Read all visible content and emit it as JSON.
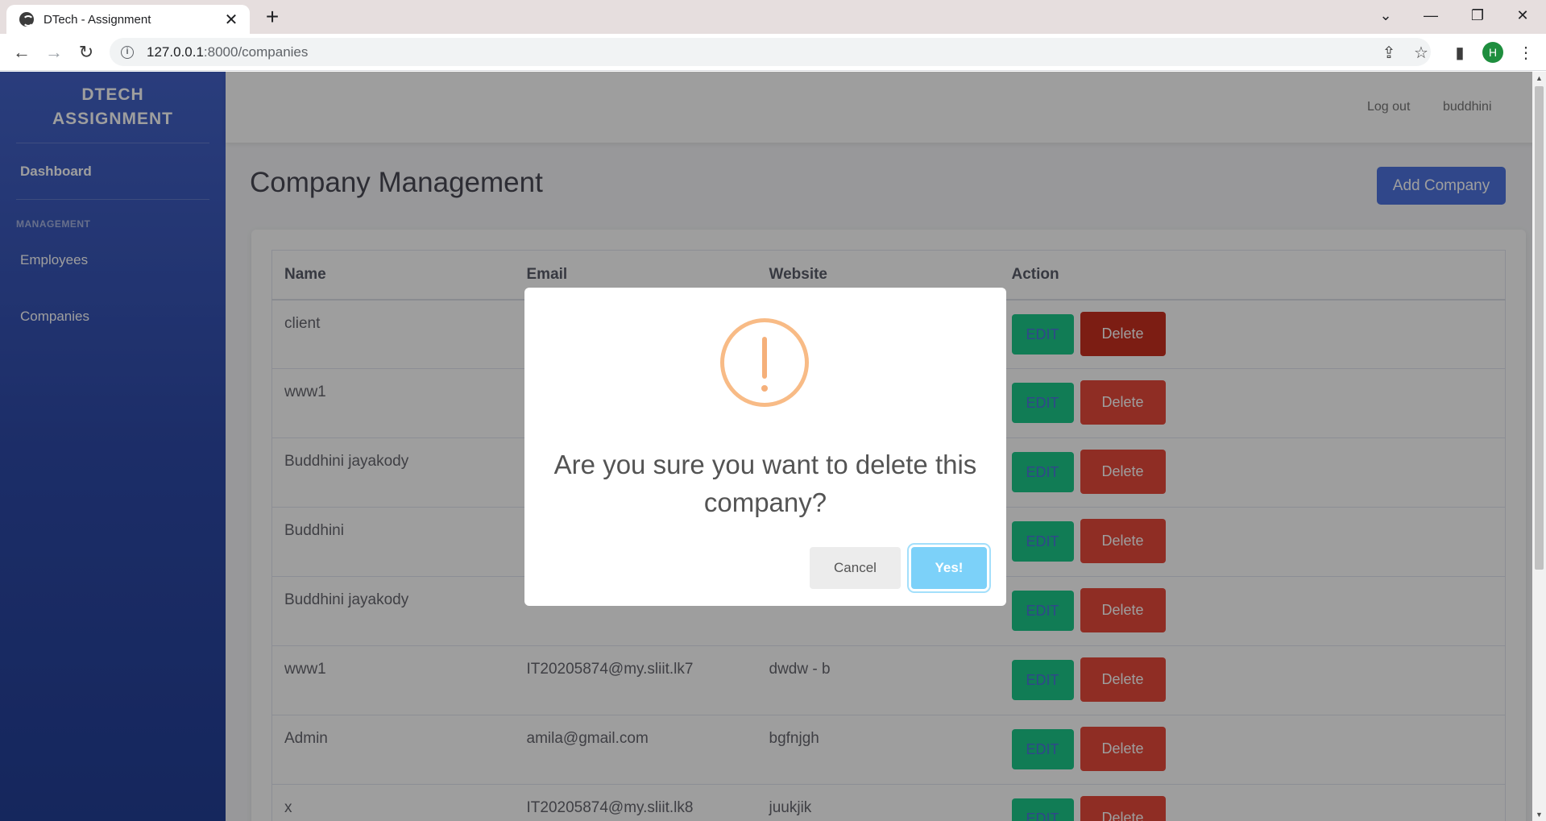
{
  "browser": {
    "tab_title": "DTech - Assignment",
    "tab_close": "✕",
    "new_tab": "+",
    "url_host": "127.0.0.1",
    "url_path": ":8000/companies",
    "profile_initial": "H",
    "controls": {
      "dropdown": "⌄",
      "minimize": "—",
      "restore": "❐",
      "close": "✕"
    }
  },
  "sidebar": {
    "brand_line1": "DTECH",
    "brand_line2": "ASSIGNMENT",
    "dashboard": "Dashboard",
    "section_heading": "MANAGEMENT",
    "items": [
      {
        "label": "Employees"
      },
      {
        "label": "Companies"
      }
    ]
  },
  "topnav": {
    "logout": "Log out",
    "user": "buddhini"
  },
  "main": {
    "title": "Company Management",
    "add_button": "Add Company",
    "table": {
      "headers": [
        "Name",
        "Email",
        "Website",
        "Action"
      ],
      "edit_label": "EDIT",
      "delete_label": "Delete",
      "rows": [
        {
          "name": "client",
          "email": "",
          "website": ""
        },
        {
          "name": "www1",
          "email": "",
          "website": ""
        },
        {
          "name": "Buddhini jayakody",
          "email": "",
          "website": ""
        },
        {
          "name": "Buddhini",
          "email": "",
          "website": ""
        },
        {
          "name": "Buddhini jayakody",
          "email": "",
          "website": ""
        },
        {
          "name": "www1",
          "email": "IT20205874@my.sliit.lk7",
          "website": "dwdw - b"
        },
        {
          "name": "Admin",
          "email": "amila@gmail.com",
          "website": "bgfnjgh"
        },
        {
          "name": "x",
          "email": "IT20205874@my.sliit.lk8",
          "website": "juukjik"
        }
      ]
    }
  },
  "modal": {
    "message": "Are you sure you want to delete this company?",
    "cancel": "Cancel",
    "confirm": "Yes!",
    "icon": "warning-icon",
    "icon_color": "#f8bb86"
  },
  "colors": {
    "sidebar_top": "#4463c9",
    "sidebar_bottom": "#233f96",
    "primary": "#4e73df",
    "success": "#1cc88a",
    "danger": "#e74a3b",
    "confirm": "#7cd1f9"
  }
}
